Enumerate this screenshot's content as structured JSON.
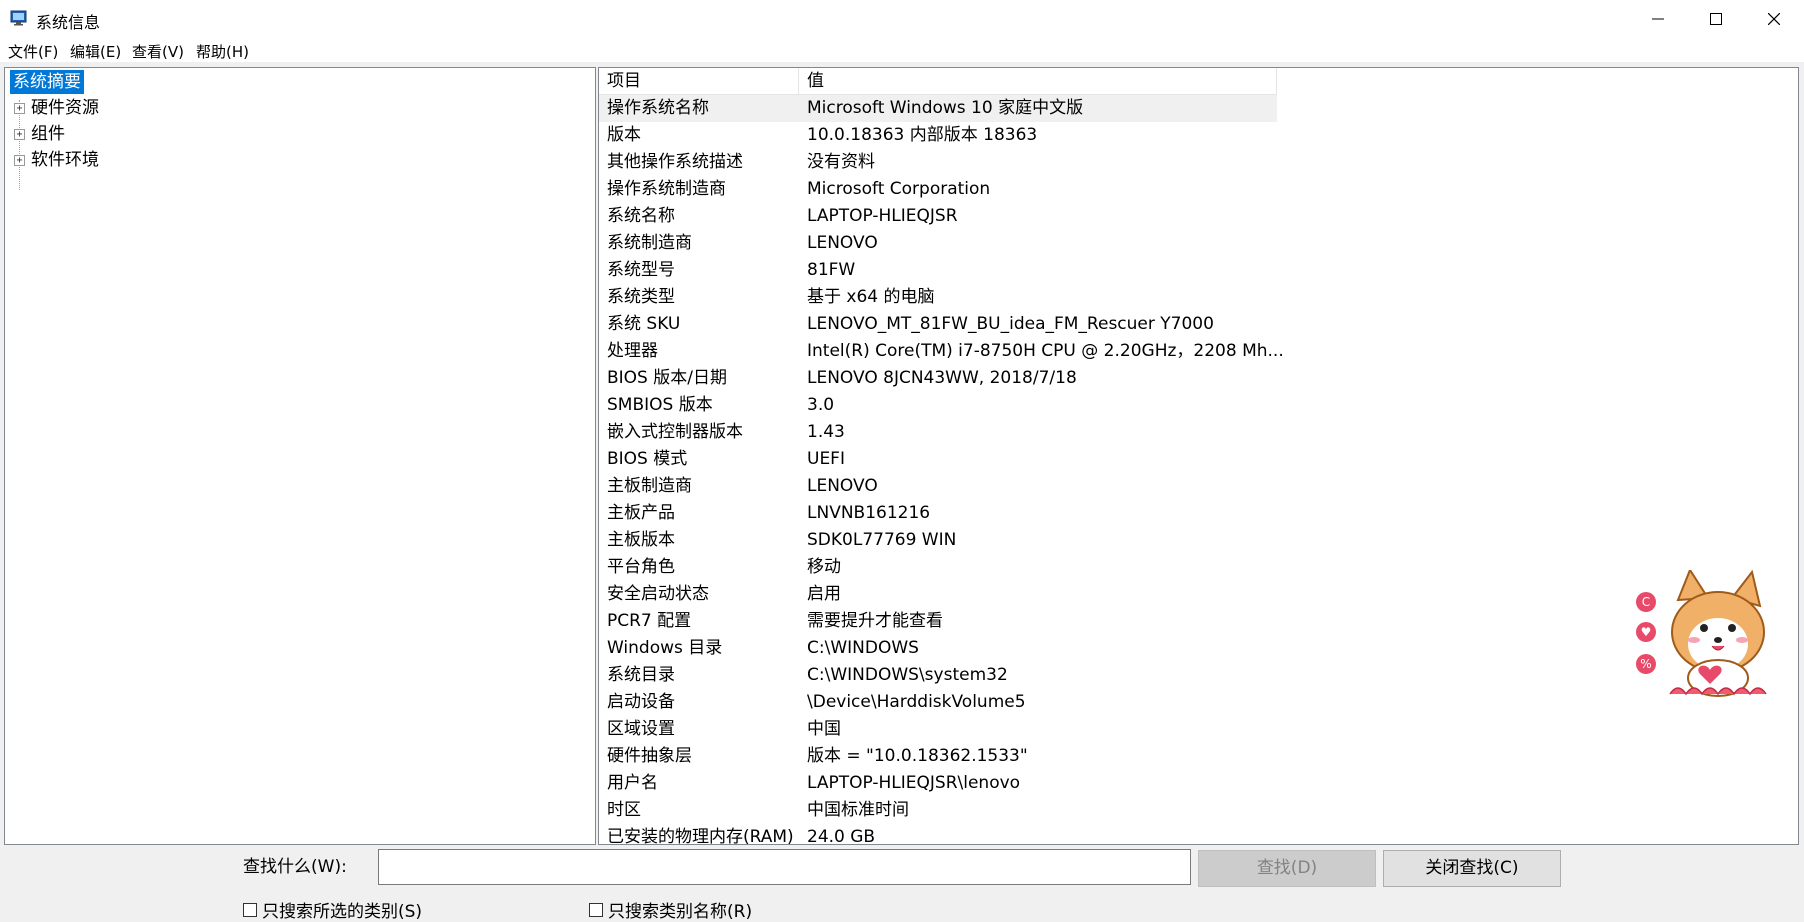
{
  "window": {
    "title": "系统信息",
    "minimize_icon": "minimize-icon",
    "maximize_icon": "maximize-icon",
    "close_icon": "close-icon"
  },
  "menu": [
    "文件(F)",
    "编辑(E)",
    "查看(V)",
    "帮助(H)"
  ],
  "tree": {
    "items": [
      {
        "label": "系统摘要",
        "selected": true,
        "expandable": false
      },
      {
        "label": "硬件资源",
        "selected": false,
        "expandable": true
      },
      {
        "label": "组件",
        "selected": false,
        "expandable": true
      },
      {
        "label": "软件环境",
        "selected": false,
        "expandable": true
      }
    ],
    "expander_symbol": "+"
  },
  "table": {
    "headers": [
      "项目",
      "值"
    ],
    "rows": [
      [
        "操作系统名称",
        "Microsoft Windows 10 家庭中文版"
      ],
      [
        "版本",
        "10.0.18363 内部版本 18363"
      ],
      [
        "其他操作系统描述",
        "没有资料"
      ],
      [
        "操作系统制造商",
        "Microsoft Corporation"
      ],
      [
        "系统名称",
        "LAPTOP-HLIEQJSR"
      ],
      [
        "系统制造商",
        "LENOVO"
      ],
      [
        "系统型号",
        "81FW"
      ],
      [
        "系统类型",
        "基于 x64 的电脑"
      ],
      [
        "系统 SKU",
        "LENOVO_MT_81FW_BU_idea_FM_Rescuer Y7000"
      ],
      [
        "处理器",
        "Intel(R) Core(TM) i7-8750H CPU @ 2.20GHz，2208 Mh..."
      ],
      [
        "BIOS 版本/日期",
        "LENOVO 8JCN43WW, 2018/7/18"
      ],
      [
        "SMBIOS 版本",
        "3.0"
      ],
      [
        "嵌入式控制器版本",
        "1.43"
      ],
      [
        "BIOS 模式",
        "UEFI"
      ],
      [
        "主板制造商",
        "LENOVO"
      ],
      [
        "主板产品",
        "LNVNB161216"
      ],
      [
        "主板版本",
        "SDK0L77769 WIN"
      ],
      [
        "平台角色",
        "移动"
      ],
      [
        "安全启动状态",
        "启用"
      ],
      [
        "PCR7 配置",
        "需要提升才能查看"
      ],
      [
        "Windows 目录",
        "C:\\WINDOWS"
      ],
      [
        "系统目录",
        "C:\\WINDOWS\\system32"
      ],
      [
        "启动设备",
        "\\Device\\HarddiskVolume5"
      ],
      [
        "区域设置",
        "中国"
      ],
      [
        "硬件抽象层",
        "版本 = \"10.0.18362.1533\""
      ],
      [
        "用户名",
        "LAPTOP-HLIEQJSR\\lenovo"
      ],
      [
        "时区",
        "中国标准时间"
      ],
      [
        "已安装的物理内存(RAM)",
        "24.0 GB"
      ]
    ],
    "selected_row": 0
  },
  "find": {
    "label": "查找什么(W):",
    "value": "",
    "find_button": "查找(D)",
    "close_button": "关闭查找(C)",
    "check_selected_only": "只搜索所选的类别(S)",
    "check_names_only": "只搜索类别名称(R)"
  },
  "overlay": {
    "mascot_icon": "corgi-mascot-icon",
    "side_icons": [
      "C",
      "♥",
      "%"
    ]
  },
  "colors": {
    "selection": "#0078d7",
    "row_highlight": "#f0f0f0",
    "accent_pink": "#e84b6a"
  }
}
